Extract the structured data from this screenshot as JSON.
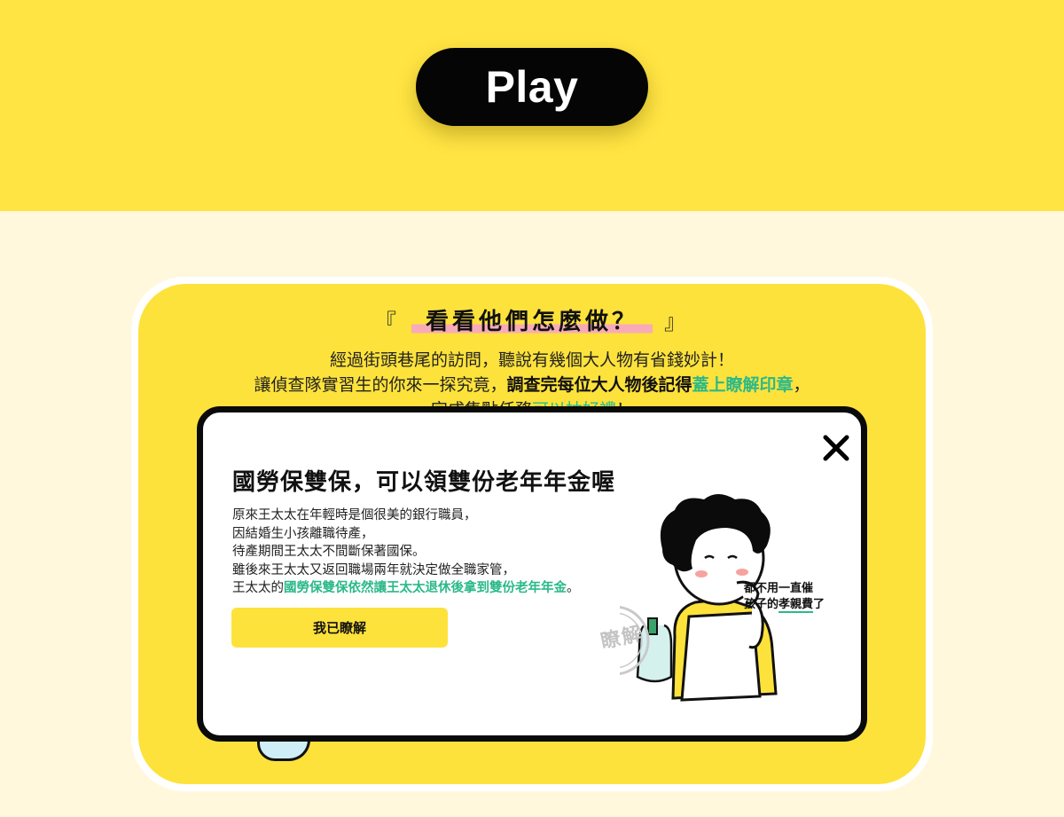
{
  "hero": {
    "play_label": "Play"
  },
  "section": {
    "heading_open": "『",
    "heading": "看看他們怎麼做？",
    "heading_close": "』",
    "intro_line1": "經過街頭巷尾的訪問，聽說有幾個大人物有省錢妙計！",
    "intro_line2_a": "讓偵查隊實習生的你來一探究竟，",
    "intro_line2_b": "調查完每位大人物後記得",
    "intro_line2_c": "蓋上瞭解印章",
    "intro_line2_d": "，",
    "intro_line3_a": "完成集點任務",
    "intro_line3_b": "可以抽好禮",
    "intro_line3_c": "！"
  },
  "modal": {
    "close_icon": "close-icon",
    "title": "國勞保雙保，可以領雙份老年年金喔",
    "lines": [
      "原來王太太在年輕時是個很美的銀行職員，",
      "因結婚生小孩離職待產，",
      "待產期間王太太不間斷保著國保。",
      "雖後來王太太又返回職場兩年就決定做全職家管，"
    ],
    "last_line_a": "王太太的",
    "last_line_b": "國勞保雙保依然讓王太太退休後拿到雙份老年年金",
    "last_line_c": "。",
    "ok_label": "我已瞭解",
    "caption_line1": "都不用一直催",
    "caption_line2_a": "孩子的",
    "caption_line2_b": "孝親費",
    "caption_line2_c": "了",
    "stamp_text": "瞭解"
  },
  "colors": {
    "top_band": "#ffe443",
    "page_bg": "#fff8dc",
    "card_yellow": "#fde23b",
    "accent_green": "#2bb98a",
    "highlight_pink": "#f9aab9"
  }
}
